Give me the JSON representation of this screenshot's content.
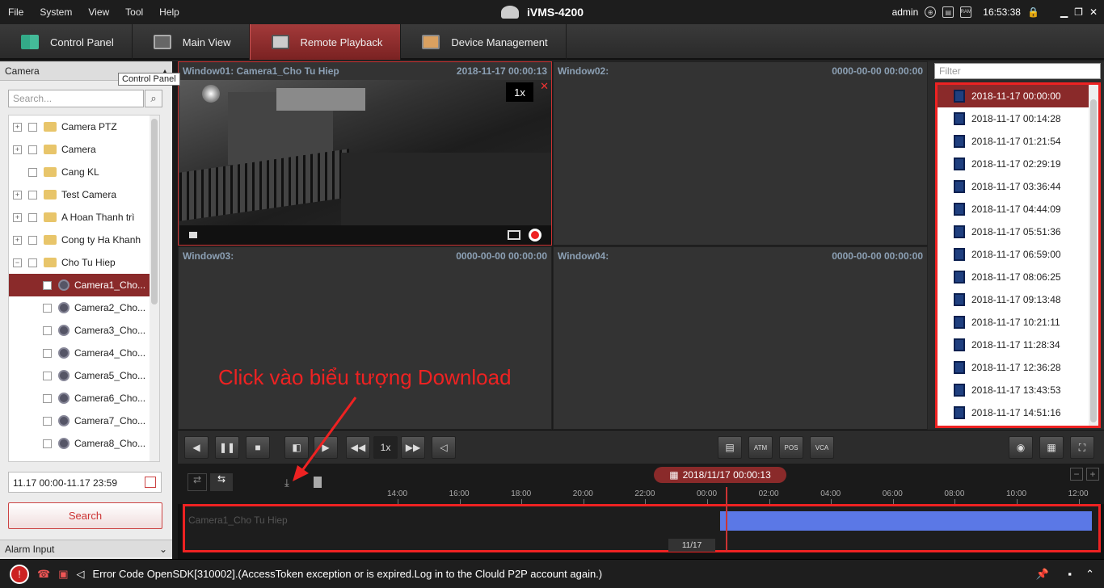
{
  "menu": [
    "File",
    "System",
    "View",
    "Tool",
    "Help"
  ],
  "app_title": "iVMS-4200",
  "sys": {
    "user": "admin",
    "time": "16:53:38",
    "ram": "RAM"
  },
  "tabs": [
    {
      "label": "Control Panel",
      "icon": "grid-icon"
    },
    {
      "label": "Main View",
      "icon": "monitor-icon"
    },
    {
      "label": "Remote Playback",
      "icon": "playback-icon",
      "active": true
    },
    {
      "label": "Device Management",
      "icon": "device-icon"
    }
  ],
  "left": {
    "camera_header": "Camera",
    "tooltip": "Control Panel",
    "search_placeholder": "Search...",
    "tree": [
      {
        "label": "Camera PTZ",
        "type": "folder",
        "expand": "+"
      },
      {
        "label": "Camera",
        "type": "folder",
        "expand": "+"
      },
      {
        "label": "Cang KL",
        "type": "folder",
        "expand": ""
      },
      {
        "label": "Test Camera",
        "type": "folder",
        "expand": "+"
      },
      {
        "label": "A Hoan Thanh trì",
        "type": "folder",
        "expand": "+"
      },
      {
        "label": "Cong ty Ha Khanh",
        "type": "folder",
        "expand": "+"
      },
      {
        "label": "Cho Tu Hiep",
        "type": "folder",
        "expand": "−"
      },
      {
        "label": "Camera1_Cho...",
        "type": "camera",
        "selected": true
      },
      {
        "label": "Camera2_Cho...",
        "type": "camera"
      },
      {
        "label": "Camera3_Cho...",
        "type": "camera"
      },
      {
        "label": "Camera4_Cho...",
        "type": "camera"
      },
      {
        "label": "Camera5_Cho...",
        "type": "camera"
      },
      {
        "label": "Camera6_Cho...",
        "type": "camera"
      },
      {
        "label": "Camera7_Cho...",
        "type": "camera"
      },
      {
        "label": "Camera8_Cho...",
        "type": "camera"
      }
    ],
    "date_range": "11.17 00:00-11.17 23:59",
    "search_button": "Search",
    "alarm_header": "Alarm Input"
  },
  "windows": [
    {
      "name": "Window01: Camera1_Cho Tu Hiep",
      "time": "2018-11-17 00:00:13",
      "speed": "1x"
    },
    {
      "name": "Window02:",
      "time": "0000-00-00 00:00:00"
    },
    {
      "name": "Window03:",
      "time": "0000-00-00 00:00:00"
    },
    {
      "name": "Window04:",
      "time": "0000-00-00 00:00:00"
    }
  ],
  "right": {
    "filter_placeholder": "Filter",
    "files": [
      "2018-11-17 00:00:00",
      "2018-11-17 00:14:28",
      "2018-11-17 01:21:54",
      "2018-11-17 02:29:19",
      "2018-11-17 03:36:44",
      "2018-11-17 04:44:09",
      "2018-11-17 05:51:36",
      "2018-11-17 06:59:00",
      "2018-11-17 08:06:25",
      "2018-11-17 09:13:48",
      "2018-11-17 10:21:11",
      "2018-11-17 11:28:34",
      "2018-11-17 12:36:28",
      "2018-11-17 13:43:53",
      "2018-11-17 14:51:16"
    ]
  },
  "controls": {
    "speed": "1x",
    "buttons": [
      "ATM",
      "POS",
      "VCA"
    ]
  },
  "timeline": {
    "date": "2018/11/17 00:00:13",
    "ticks": [
      "14:00",
      "16:00",
      "18:00",
      "20:00",
      "22:00",
      "00:00",
      "02:00",
      "04:00",
      "06:00",
      "08:00",
      "10:00",
      "12:00"
    ],
    "track_label": "Camera1_Cho Tu Hiep",
    "mini_date": "11/17"
  },
  "annotation": "Click vào biểu tượng Download",
  "status": "Error Code OpenSDK[310002].(AccessToken exception or is expired.Log in to the Clould P2P account again.)"
}
